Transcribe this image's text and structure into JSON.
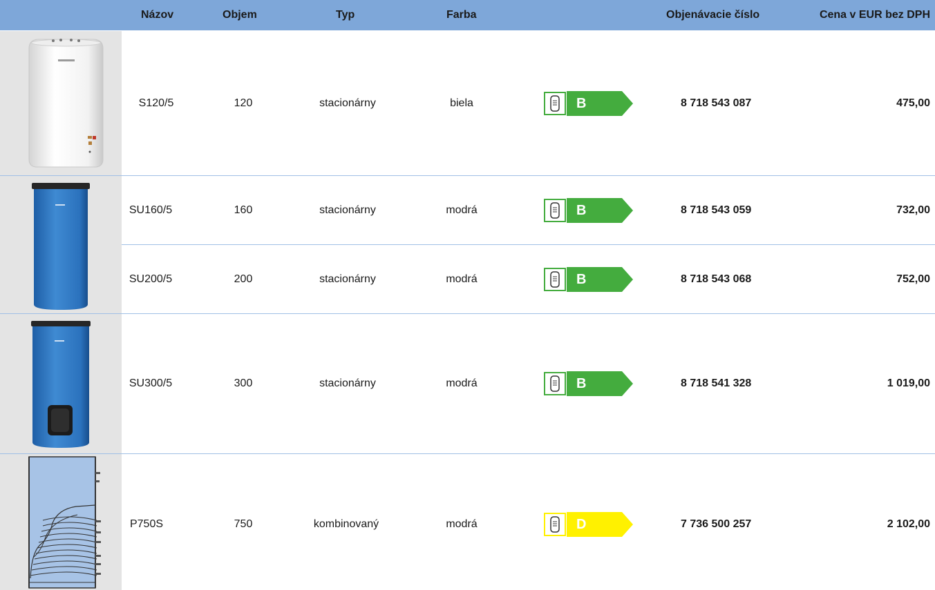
{
  "header": {
    "col_name": "Názov",
    "col_volume": "Objem",
    "col_type": "Typ",
    "col_color": "Farba",
    "col_order": "Objenávacie číslo",
    "col_price": "Cena v EUR bez DPH"
  },
  "colors": {
    "header_bg": "#7ea7d9",
    "image_bg": "#e4e4e4",
    "class_b": "#44ac3e",
    "class_d": "#fff100",
    "divider": "#9fbfe5"
  },
  "rows": [
    {
      "name": "S120/5",
      "volume": "120",
      "type": "stacionárny",
      "color": "biela",
      "energy_class": "B",
      "order_number": "8 718 543 087",
      "price": "475,00"
    },
    {
      "name": "SU160/5",
      "volume": "160",
      "type": "stacionárny",
      "color": "modrá",
      "energy_class": "B",
      "order_number": "8 718 543 059",
      "price": "732,00"
    },
    {
      "name": "SU200/5",
      "volume": "200",
      "type": "stacionárny",
      "color": "modrá",
      "energy_class": "B",
      "order_number": "8 718 543 068",
      "price": "752,00"
    },
    {
      "name": "SU300/5",
      "volume": "300",
      "type": "stacionárny",
      "color": "modrá",
      "energy_class": "B",
      "order_number": "8 718 541 328",
      "price": "1 019,00"
    },
    {
      "name": "P750S",
      "volume": "750",
      "type": "kombinovaný",
      "color": "modrá",
      "energy_class": "D",
      "order_number": "7 736 500 257",
      "price": "2 102,00"
    }
  ],
  "images": [
    {
      "icon": "white-water-heater-icon"
    },
    {
      "icon": "blue-water-heater-icon"
    },
    {
      "icon": "blue-water-heater-with-flange-icon"
    },
    {
      "icon": "combined-tank-cutaway-icon"
    }
  ]
}
